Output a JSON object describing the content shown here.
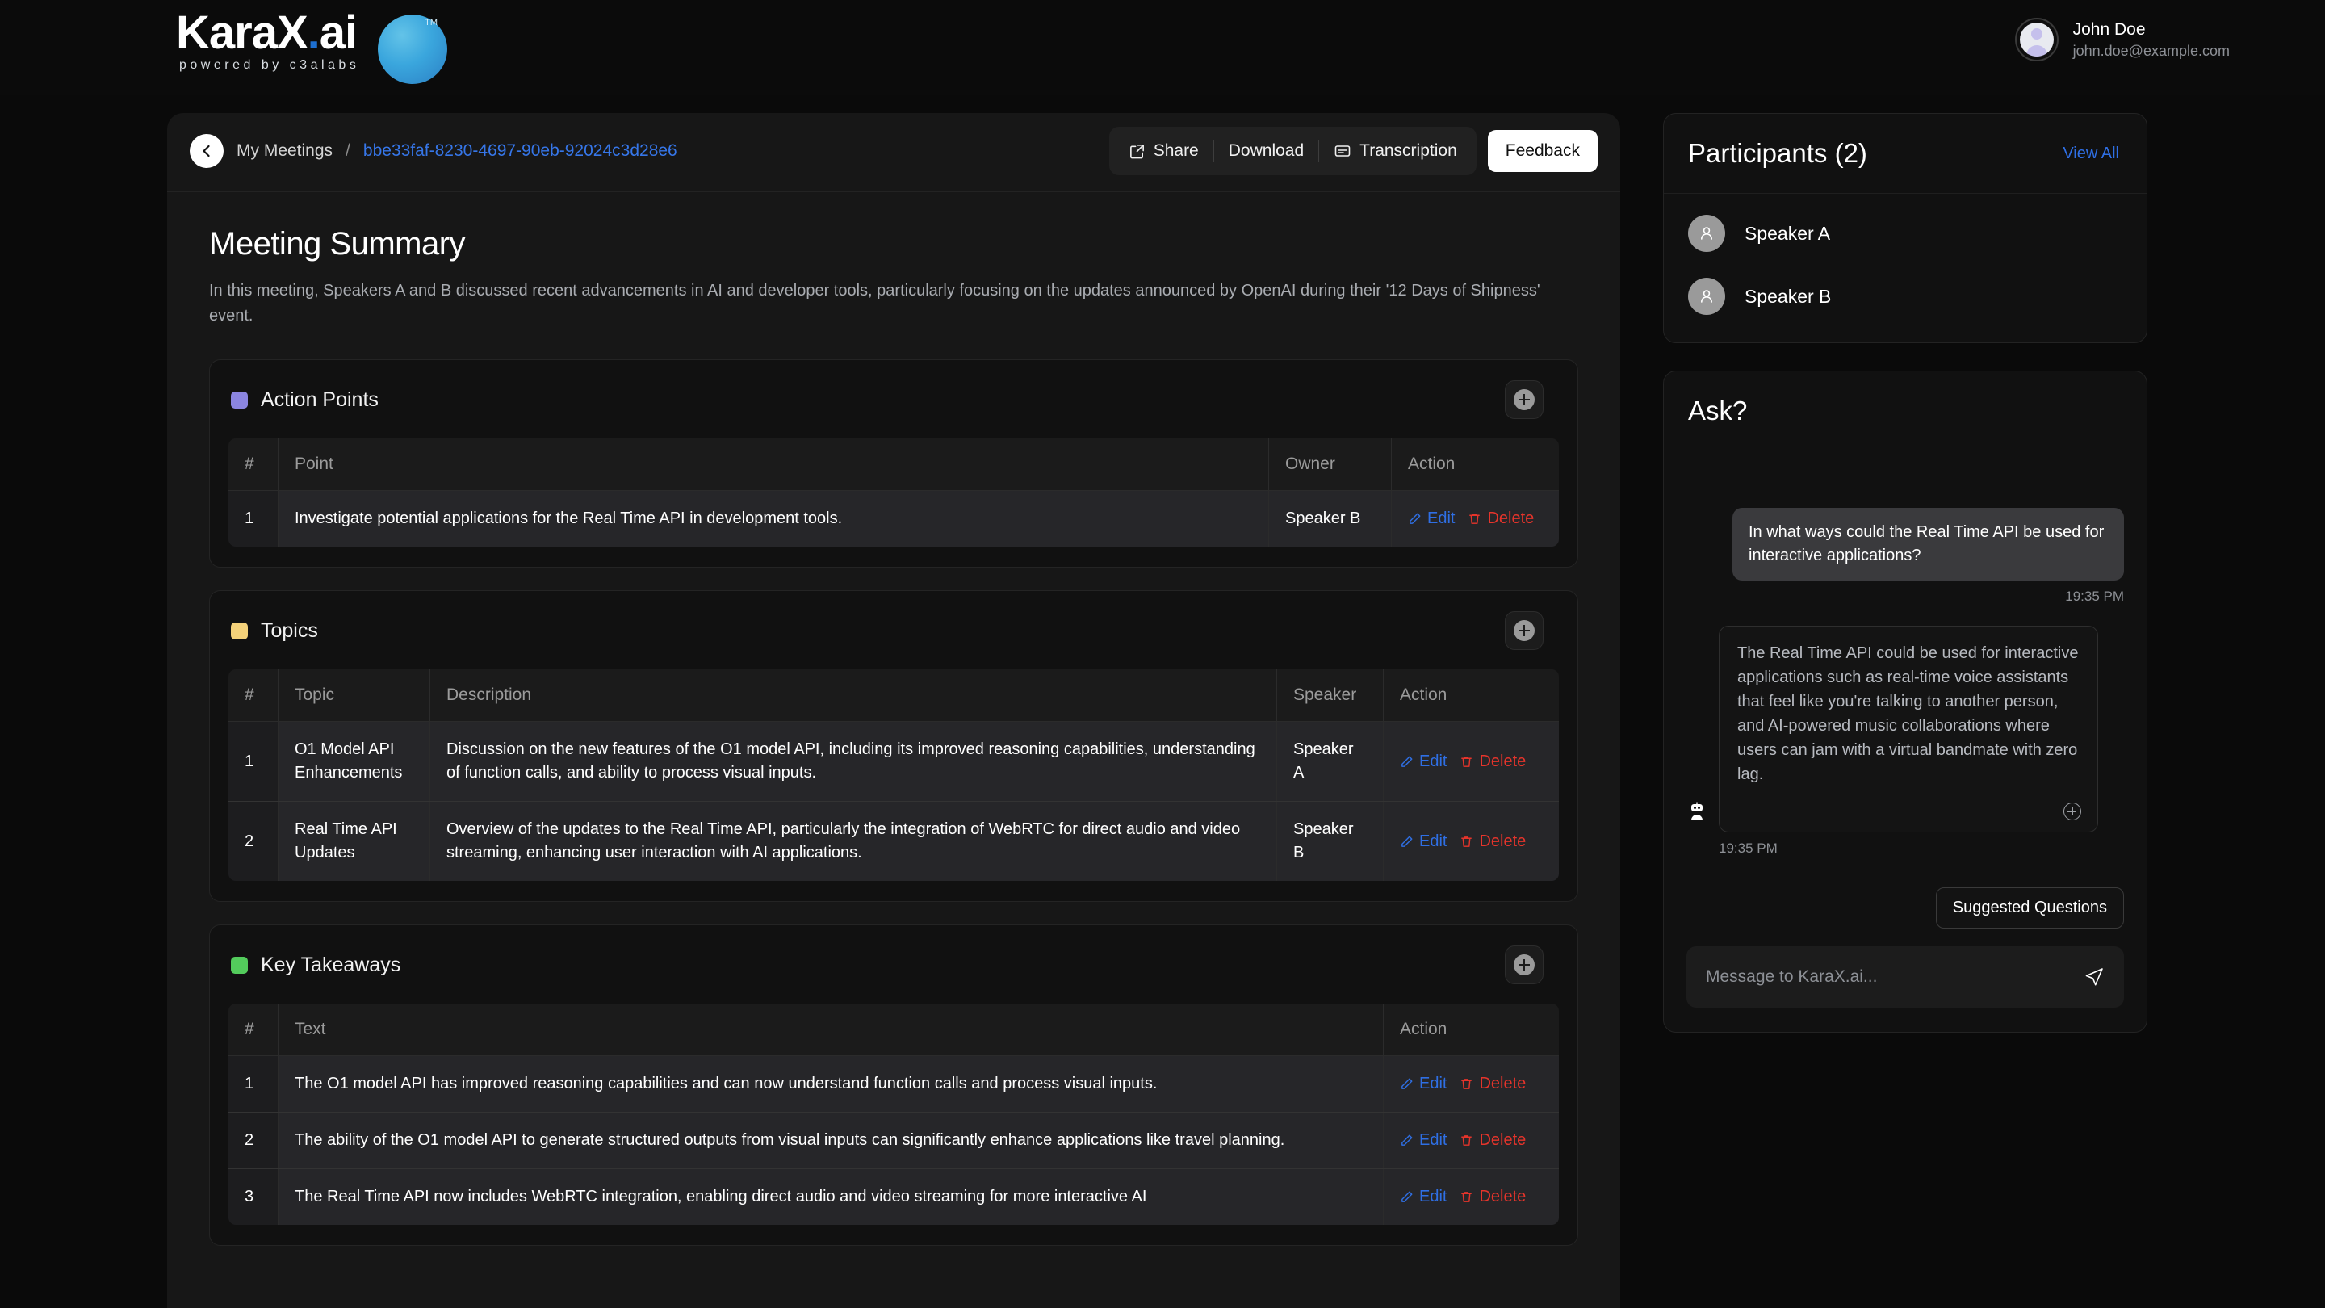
{
  "brand": {
    "name_main": "KaraX",
    "name_dot": ".",
    "name_ai": "ai",
    "tagline": "powered by c3alabs",
    "trademark": "TM"
  },
  "user": {
    "name": "John Doe",
    "email": "john.doe@example.com"
  },
  "breadcrumb": {
    "root": "My Meetings",
    "separator": "/",
    "meeting_id": "bbe33faf-8230-4697-90eb-92024c3d28e6"
  },
  "toolbar": {
    "share": "Share",
    "download": "Download",
    "transcription": "Transcription",
    "feedback": "Feedback"
  },
  "summary": {
    "title": "Meeting Summary",
    "description": "In this meeting, Speakers A and B discussed recent advancements in AI and developer tools, particularly focusing on the updates announced by OpenAI during their '12 Days of Shipness' event."
  },
  "actions_labels": {
    "edit": "Edit",
    "delete": "Delete"
  },
  "sections": {
    "action_points": {
      "label": "Action Points",
      "swatch_color": "#8b85e0",
      "columns": [
        "#",
        "Point",
        "Owner",
        "Action"
      ],
      "rows": [
        {
          "index": "1",
          "point": "Investigate potential applications for the Real Time API in development tools.",
          "owner": "Speaker B"
        }
      ]
    },
    "topics": {
      "label": "Topics",
      "swatch_color": "#f4d27a",
      "columns": [
        "#",
        "Topic",
        "Description",
        "Speaker",
        "Action"
      ],
      "rows": [
        {
          "index": "1",
          "topic": "O1 Model API Enhancements",
          "description": "Discussion on the new features of the O1 model API, including its improved reasoning capabilities, understanding of function calls, and ability to process visual inputs.",
          "speaker": "Speaker A"
        },
        {
          "index": "2",
          "topic": "Real Time API Updates",
          "description": "Overview of the updates to the Real Time API, particularly the integration of WebRTC for direct audio and video streaming, enhancing user interaction with AI applications.",
          "speaker": "Speaker B"
        }
      ]
    },
    "key_takeaways": {
      "label": "Key Takeaways",
      "swatch_color": "#53cc5c",
      "columns": [
        "#",
        "Text",
        "Action"
      ],
      "rows": [
        {
          "index": "1",
          "text": "The O1 model API has improved reasoning capabilities and can now understand function calls and process visual inputs."
        },
        {
          "index": "2",
          "text": "The ability of the O1 model API to generate structured outputs from visual inputs can significantly enhance applications like travel planning."
        },
        {
          "index": "3",
          "text": "The Real Time API now includes WebRTC integration, enabling direct audio and video streaming for more interactive AI"
        }
      ]
    }
  },
  "participants": {
    "title": "Participants (2)",
    "view_all": "View All",
    "items": [
      {
        "name": "Speaker A"
      },
      {
        "name": "Speaker B"
      }
    ]
  },
  "ask": {
    "title": "Ask?",
    "messages": [
      {
        "role": "user",
        "text": "In what ways could the Real Time API be used for interactive applications?",
        "time": "19:35 PM"
      },
      {
        "role": "assistant",
        "text": "The Real Time API could be used for interactive applications such as real-time voice assistants that feel like you're talking to another person, and AI-powered music collaborations where users can jam with a virtual bandmate with zero lag.",
        "time": "19:35 PM"
      }
    ],
    "suggested_questions_label": "Suggested Questions",
    "composer_placeholder": "Message to KaraX.ai...",
    "composer_value": ""
  }
}
